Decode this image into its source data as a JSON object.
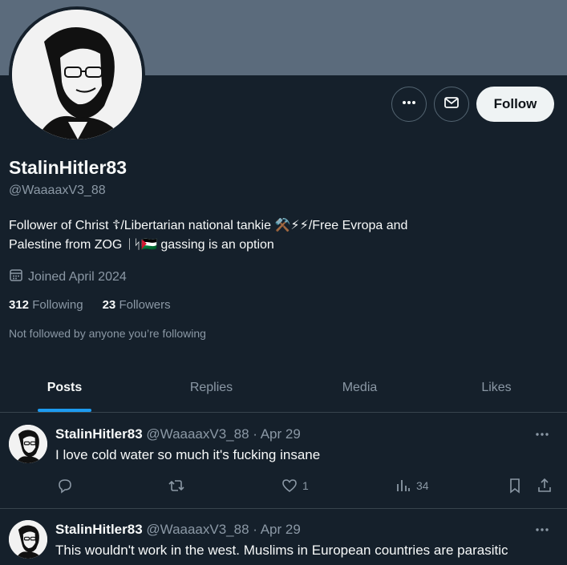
{
  "profile": {
    "name": "StalinHitler83",
    "handle": "@WaaaaxV3_88",
    "bio_line1": "Follower of Christ ☦/Libertarian national tankie ⚒️⚡⚡/Free Evropa and",
    "bio_line2": "Palestine from ZOG ᛁᛋ🇵🇸 gassing is an option",
    "joined": "Joined April 2024",
    "following_count": "312",
    "following_label": "Following",
    "followers_count": "23",
    "followers_label": "Followers",
    "not_followed": "Not followed by anyone you’re following",
    "follow_label": "Follow"
  },
  "tabs": [
    {
      "label": "Posts",
      "active": true
    },
    {
      "label": "Replies"
    },
    {
      "label": "Media"
    },
    {
      "label": "Likes"
    }
  ],
  "posts": [
    {
      "name": "StalinHitler83",
      "meta": "@WaaaaxV3_88 · Apr 29",
      "text": "I love cold water so much it's fucking insane",
      "reply_count": "",
      "repost_count": "",
      "like_count": "1",
      "view_count": "34"
    },
    {
      "name": "StalinHitler83",
      "meta": "@WaaaaxV3_88 · Apr 29",
      "text": "This wouldn't work in the west. Muslims in European countries are parasitic"
    }
  ],
  "colors": {
    "background": "#15202b",
    "banner": "#5b6b7c",
    "accent": "#1d9bf0",
    "muted": "#8b98a5"
  },
  "icons": {
    "more": "more-icon",
    "message": "mail-icon",
    "calendar": "calendar-icon",
    "reply": "reply-icon",
    "repost": "repost-icon",
    "like": "heart-icon",
    "views": "views-icon",
    "bookmark": "bookmark-icon",
    "share": "share-icon"
  }
}
